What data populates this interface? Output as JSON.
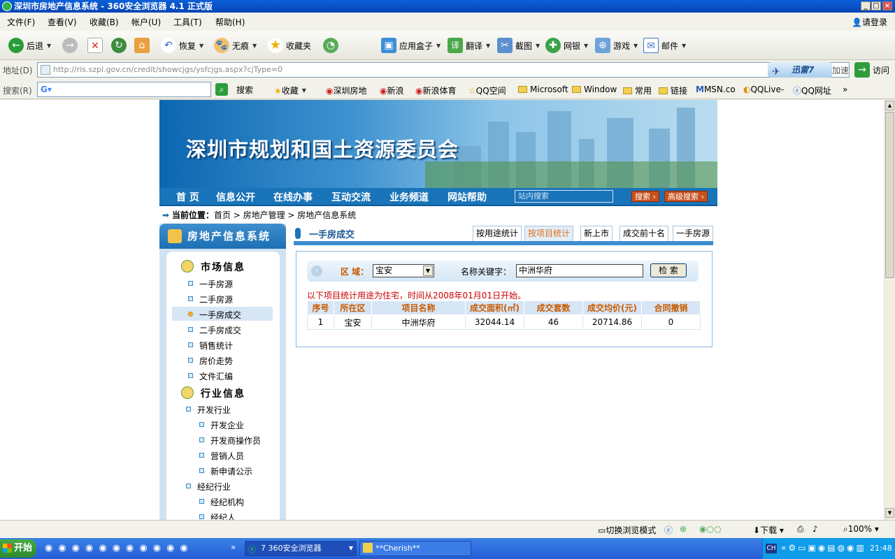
{
  "window": {
    "title": "深圳市房地产信息系统 - 360安全浏览器 4.1 正式版",
    "login": "请登录"
  },
  "menu": [
    "文件(F)",
    "查看(V)",
    "收藏(B)",
    "帐户(U)",
    "工具(T)",
    "帮助(H)"
  ],
  "toolbar": {
    "back": "后退",
    "restore": "恢复",
    "private": "无痕",
    "favorites": "收藏夹",
    "appbox": "应用盒子",
    "translate": "翻译",
    "screenshot": "截图",
    "bank": "网银",
    "games": "游戏",
    "mail": "邮件"
  },
  "address": {
    "label": "地址(D)",
    "url": "http://ris.szpl.gov.cn/credit/showcjgs/ysfcjgs.aspx?cjType=0",
    "xunlei": "迅雷7",
    "speed": "加速",
    "go": "访问"
  },
  "searchbar": {
    "label": "搜索(R)",
    "button": "搜索",
    "more": "»",
    "favs": [
      "收藏",
      "深圳房地",
      "新浪",
      "新浪体育",
      "QQ空间",
      "Microsoft",
      "Window",
      "常用",
      "链接",
      "MSN.co",
      "QQLive-",
      "QQ网址"
    ]
  },
  "banner": {
    "title": "深圳市规划和国土资源委员会"
  },
  "nav": {
    "items": [
      "首 页",
      "信息公开",
      "在线办事",
      "互动交流",
      "业务频道",
      "网站帮助"
    ],
    "search_placeholder": "站内搜索",
    "search_btn": "搜索",
    "adv_search_btn": "高级搜索"
  },
  "breadcrumb": {
    "label": "当前位置：",
    "path": "首页 > 房地产管理 > 房地产信息系统"
  },
  "sidebar": {
    "title": "房地产信息系统",
    "group1": "市场信息",
    "group1_items": [
      "一手房源",
      "二手房源",
      "一手房成交",
      "二手房成交",
      "销售统计",
      "房价走势",
      "文件汇编"
    ],
    "group2": "行业信息",
    "dev": "开发行业",
    "dev_items": [
      "开发企业",
      "开发商操作员",
      "营销人员",
      "新申请公示"
    ],
    "agency": "经纪行业",
    "agency_items": [
      "经纪机构",
      "经纪人"
    ]
  },
  "main": {
    "title": "一手房成交",
    "tabs": [
      "按用途统计",
      "按项目统计",
      "新上市",
      "成交前十名",
      "一手房源"
    ],
    "active_tab": "按项目统计"
  },
  "filter": {
    "district_label": "区 域：",
    "district_value": "宝安",
    "keyword_label": "名称关键字：",
    "keyword_value": "中洲华府",
    "search_button": "检 索"
  },
  "note": "以下项目统计用途为住宅，时间从2008年01月01日开始。",
  "table": {
    "headers": [
      "序号",
      "所在区",
      "项目名称",
      "成交面积(㎡)",
      "成交套数",
      "成交均价(元)",
      "合同撤销"
    ],
    "rows": [
      [
        "1",
        "宝安",
        "中洲华府",
        "32044.14",
        "46",
        "20714.86",
        "0"
      ]
    ]
  },
  "status": {
    "mode": "切换浏览模式",
    "download": "下载",
    "zoom": "100%"
  },
  "taskbar": {
    "start": "开始",
    "task1": "7 360安全浏览器",
    "task2": "**Cherish**",
    "lang": "CH",
    "clock": "21:48"
  }
}
